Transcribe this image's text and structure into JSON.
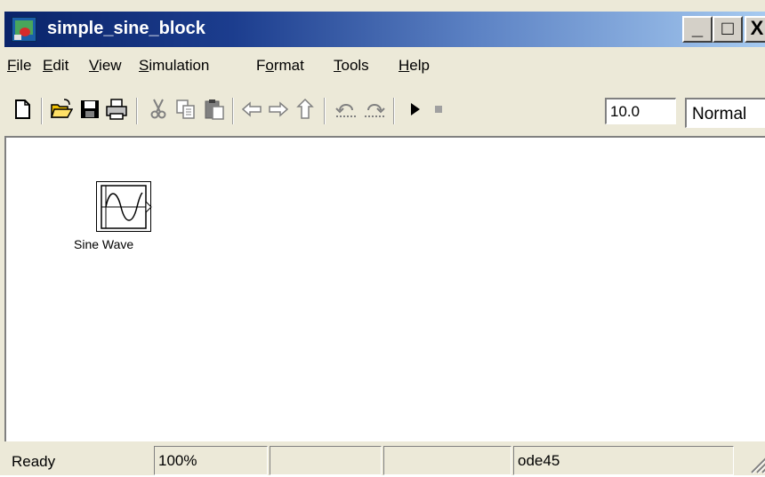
{
  "window": {
    "title": "simple_sine_block",
    "buttons": {
      "minimize": "_",
      "maximize": "□",
      "close": "X"
    }
  },
  "menubar": {
    "items": [
      {
        "label": "File",
        "access": "F",
        "rest": "ile"
      },
      {
        "label": "Edit",
        "access": "E",
        "rest": "dit"
      },
      {
        "label": "View",
        "access": "V",
        "rest": "iew"
      },
      {
        "label": "Simulation",
        "access": "S",
        "rest": "imulation"
      },
      {
        "label": "Format",
        "pre": "F",
        "access": "o",
        "rest": "rmat"
      },
      {
        "label": "Tools",
        "access": "T",
        "rest": "ools"
      },
      {
        "label": "Help",
        "access": "H",
        "rest": "elp"
      }
    ]
  },
  "toolbar": {
    "icons": [
      "new-model-icon",
      "open-icon",
      "save-icon",
      "print-icon",
      "cut-icon",
      "copy-icon",
      "paste-icon",
      "back-arrow-icon",
      "forward-arrow-icon",
      "up-arrow-icon",
      "undo-icon",
      "redo-icon",
      "start-simulation-icon",
      "stop-simulation-icon"
    ],
    "stop_time": "10.0",
    "simulation_mode": "Normal"
  },
  "canvas": {
    "blocks": [
      {
        "name": "Sine Wave",
        "icon": "sine-wave-icon"
      }
    ]
  },
  "statusbar": {
    "status": "Ready",
    "zoom": "100%",
    "blank1": "",
    "blank2": "",
    "solver": "ode45"
  }
}
